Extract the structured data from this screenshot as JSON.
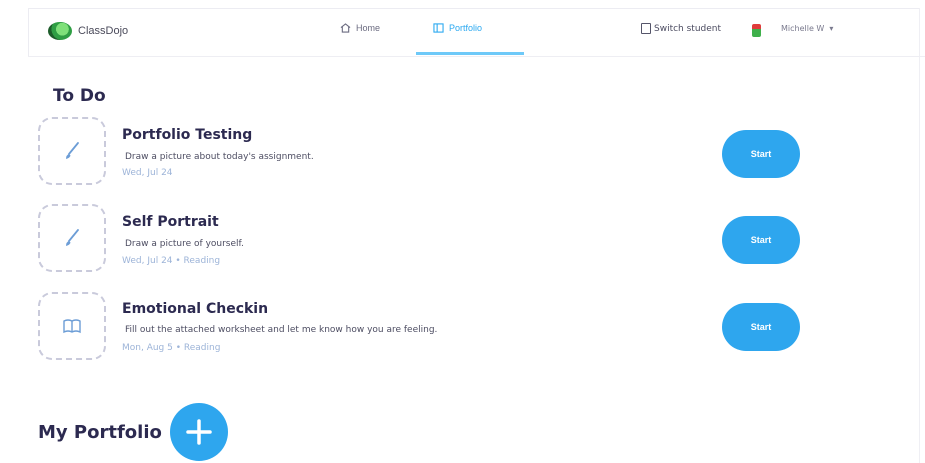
{
  "header": {
    "brand": "ClassDojo",
    "nav": {
      "home_label": "Home",
      "portfolio_label": "Portfolio"
    },
    "switch_student_label": "Switch student",
    "user_name": "Michelle W",
    "active_color": "#2aa8f0"
  },
  "todo": {
    "heading": "To Do",
    "items": [
      {
        "title": "Portfolio Testing",
        "description": "Draw a picture about today's assignment.",
        "meta": "Wed, Jul 24",
        "icon": "brush-icon",
        "button_label": "Start"
      },
      {
        "title": "Self Portrait",
        "description": "Draw a picture of yourself.",
        "meta": "Wed, Jul 24  •  Reading",
        "icon": "brush-icon",
        "button_label": "Start"
      },
      {
        "title": "Emotional Checkin",
        "description": "Fill out the attached worksheet and let me know how you are feeling.",
        "meta": "Mon, Aug 5  •  Reading",
        "icon": "book-icon",
        "button_label": "Start"
      }
    ]
  },
  "portfolio": {
    "heading": "My Portfolio"
  },
  "colors": {
    "accent": "#2ea6ee",
    "text": "#2c2a50",
    "meta": "#9db4d8"
  }
}
